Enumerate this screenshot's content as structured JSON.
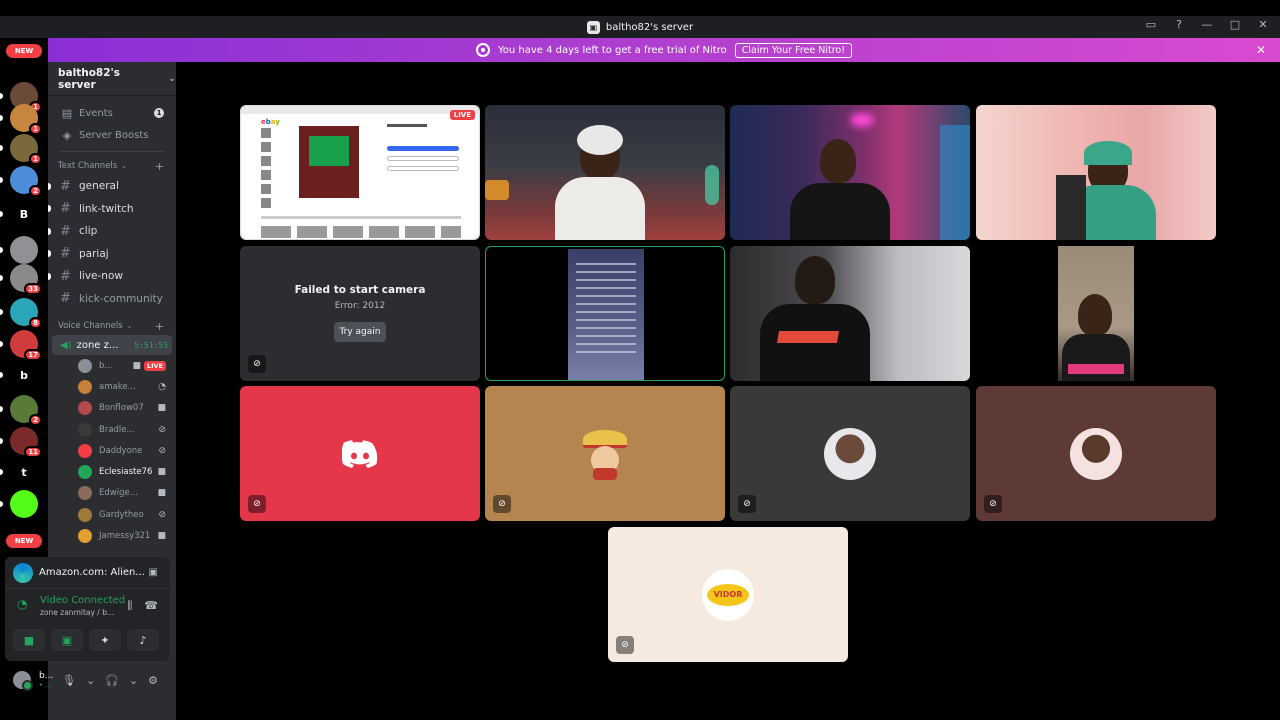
{
  "window": {
    "title": "baltho82's server",
    "controls": [
      "—",
      "□",
      "✕"
    ]
  },
  "banner": {
    "text": "You have 4 days left to get a free trial of Nitro",
    "button": "Claim Your Free Nitro!"
  },
  "rail": {
    "new_label_top": "NEW",
    "new_label_bottom": "NEW",
    "servers": [
      {
        "label": "",
        "badge": "1",
        "color": "#6b4a3a"
      },
      {
        "label": "",
        "badge": "1",
        "color": "#c7863f"
      },
      {
        "label": "",
        "badge": "1",
        "color": "#7a6a3b"
      },
      {
        "label": "",
        "badge": "2",
        "color": "#4d8cd9"
      },
      {
        "label": "B",
        "badge": "",
        "color": "#000000"
      },
      {
        "label": "",
        "badge": "",
        "color": "#8f9196"
      },
      {
        "label": "",
        "badge": "33",
        "color": "#8a8a8a"
      },
      {
        "label": "",
        "badge": "8",
        "color": "#2aa6b8"
      },
      {
        "label": "",
        "badge": "17",
        "color": "#d03b3b"
      },
      {
        "label": "b",
        "badge": "",
        "color": "#000000"
      },
      {
        "label": "",
        "badge": "2",
        "color": "#5a7a3a"
      },
      {
        "label": "",
        "badge": "11",
        "color": "#7a2a2a"
      },
      {
        "label": "t",
        "badge": "",
        "color": "#000000"
      },
      {
        "label": "",
        "badge": "",
        "color": "#53fc18"
      }
    ]
  },
  "sidebar": {
    "server_name": "baltho82's server",
    "events": "Events",
    "events_count": "1",
    "boosts": "Server Boosts",
    "text_category": "Text Channels",
    "text_channels": [
      "general",
      "link-twitch",
      "clip",
      "pariaj",
      "live-now",
      "kick-community"
    ],
    "voice_category": "Voice Channels",
    "voice_channel": {
      "name": "zone z...",
      "timer": "5:51:53"
    },
    "voice_users": [
      {
        "name": "b...",
        "live": "LIVE",
        "color": "#8b8f97"
      },
      {
        "name": "amake...",
        "live": "",
        "color": "#c87f3a"
      },
      {
        "name": "Bonflow07",
        "live": "",
        "color": "#b24a4a"
      },
      {
        "name": "Bradle...",
        "live": "",
        "color": "#3a3a3a"
      },
      {
        "name": "Daddyone",
        "live": "",
        "color": "#f23f43"
      },
      {
        "name": "Eclesiaste76",
        "live": "",
        "color": "#23a55a"
      },
      {
        "name": "Edwige...",
        "live": "",
        "color": "#8a6a5a"
      },
      {
        "name": "Gardytheo",
        "live": "",
        "color": "#a07a3a"
      },
      {
        "name": "Jamessy321",
        "live": "",
        "color": "#e0a030"
      }
    ]
  },
  "activity": {
    "title": "Amazon.com: Alien..."
  },
  "voice_panel": {
    "status": "Video Connected",
    "location": "zone zanmitay / b..."
  },
  "user": {
    "name": "b...",
    "status": "• ..."
  },
  "grid": {
    "live_tag": "LIVE",
    "failed_title": "Failed to start camera",
    "failed_error": "Error: 2012",
    "retry": "Try again",
    "avatar_label": "VIDOR"
  },
  "colors": {
    "accent_green": "#23a55a",
    "danger": "#f23f43",
    "discord_red_tile": "#e5374a",
    "tan_tile": "#b58550",
    "gray_tile": "#373a36",
    "brown_tile": "#5e3a36",
    "cream_tile": "#f6e9df"
  }
}
